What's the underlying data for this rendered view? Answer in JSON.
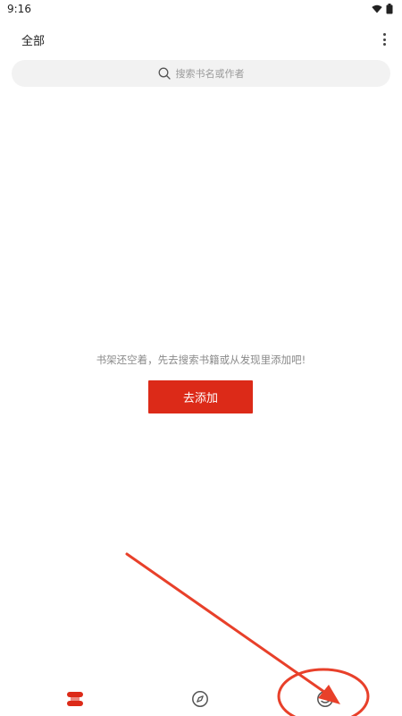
{
  "status_bar": {
    "time": "9:16",
    "icons": [
      "wifi-icon",
      "battery-icon"
    ]
  },
  "header": {
    "category_label": "全部",
    "menu_icon": "more-vertical-icon"
  },
  "search": {
    "placeholder": "搜索书名或作者",
    "icon": "search-icon"
  },
  "empty_state": {
    "message": "书架还空着，先去搜索书籍或从发现里添加吧!",
    "button_label": "去添加"
  },
  "bottom_nav": {
    "items": [
      {
        "name": "bookshelf",
        "icon": "bookshelf-icon",
        "active": true
      },
      {
        "name": "discover",
        "icon": "compass-icon",
        "active": false
      },
      {
        "name": "mine",
        "icon": "profile-icon",
        "active": false
      }
    ]
  },
  "colors": {
    "accent": "#dc2a18",
    "annotation": "#e8402a",
    "search_bg": "#f2f2f2"
  }
}
